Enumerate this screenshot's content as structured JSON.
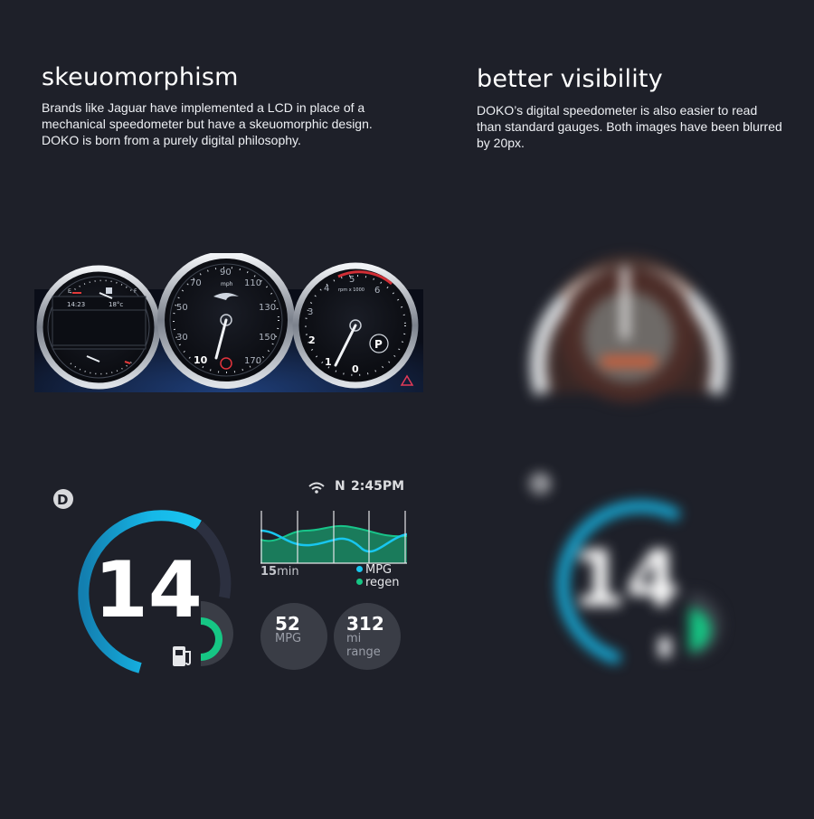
{
  "left_column": {
    "title": "skeuomorphism",
    "description": "Brands like Jaguar have implemented a LCD in place of a mechanical speedometer but have a skeuomorphic design. DOKO is born from a purely digital philosophy."
  },
  "right_column": {
    "title": "better visibility",
    "description": "DOKO’s digital speedometer is also easier to read than standard gauges. Both images have been blurred by 20px."
  },
  "jaguar_cluster": {
    "left_gauge": {
      "time": "14:23",
      "temperature": "18°c",
      "fuel_empty": "E",
      "fuel_full": "F"
    },
    "speedometer": {
      "unit": "mph",
      "ticks": [
        "10",
        "30",
        "50",
        "70",
        "90",
        "110",
        "130",
        "150",
        "170"
      ]
    },
    "tachometer": {
      "unit": "rpm x 1000",
      "ticks": [
        "0",
        "1",
        "2",
        "3",
        "4",
        "5",
        "6"
      ],
      "gear": "P"
    }
  },
  "doko_dash": {
    "drive_mode": "D",
    "speed": "14",
    "heading": "N",
    "time": "2:45PM",
    "chart_window_value": "15",
    "chart_window_unit": "min",
    "legend": [
      {
        "label": "MPG",
        "color": "#18c6ef"
      },
      {
        "label": "regen",
        "color": "#16c684"
      }
    ],
    "stats": [
      {
        "value": "52",
        "unit": "MPG"
      },
      {
        "value": "312",
        "unit": "mi range"
      }
    ],
    "colors": {
      "accent_blue": "#16b8e8",
      "accent_green": "#16c684",
      "panel": "#3a3d46"
    }
  },
  "blurred_doko": {
    "drive_mode": "D",
    "speed": "14"
  }
}
